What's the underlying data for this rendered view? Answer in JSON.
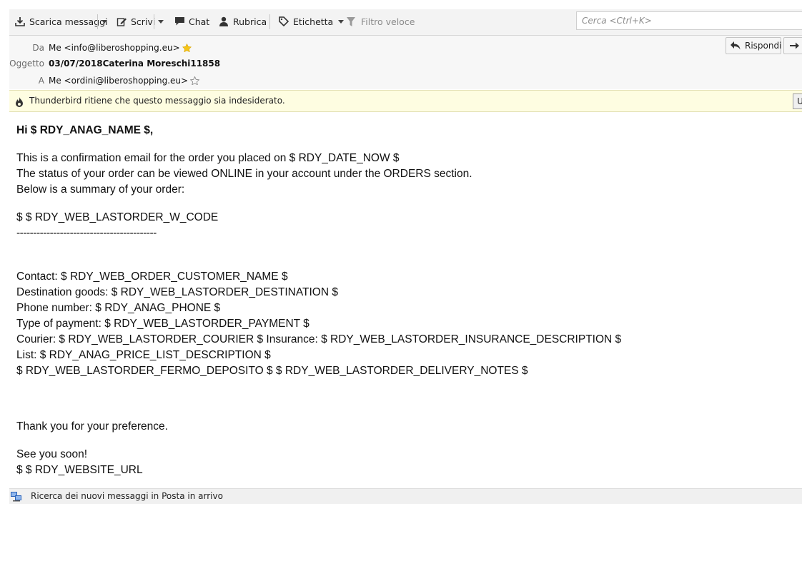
{
  "toolbar": {
    "get_messages": "Scarica messaggi",
    "write": "Scrivi",
    "chat": "Chat",
    "address_book": "Rubrica",
    "tag": "Etichetta",
    "quick_filter": "Filtro veloce",
    "search_placeholder": "Cerca <Ctrl+K>"
  },
  "header": {
    "from_label": "Da",
    "from_value": "Me <info@liberoshopping.eu>",
    "subject_label": "Oggetto",
    "subject_value": "03/07/2018Caterina Moreschi11858",
    "to_label": "A",
    "to_value": "Me <ordini@liberoshopping.eu>",
    "reply_label": "Rispondi"
  },
  "junk_bar": {
    "text": "Thunderbird ritiene che questo messaggio sia indesiderato.",
    "button_label": "U"
  },
  "message": {
    "greeting": "Hi $ RDY_ANAG_NAME $,",
    "line1": "This is a confirmation email for the order you placed on $ RDY_DATE_NOW $",
    "line2": "The status of your order can be viewed ONLINE in your account under the ORDERS section.",
    "line3": "Below is a summary of your order:",
    "order_code": "$ $ RDY_WEB_LASTORDER_W_CODE",
    "divider": "------------------------------------------",
    "contact": "Contact: $ RDY_WEB_ORDER_CUSTOMER_NAME $",
    "destination": "Destination goods: $ RDY_WEB_LASTORDER_DESTINATION $",
    "phone": "Phone number: $ RDY_ANAG_PHONE $",
    "payment": "Type of payment: $ RDY_WEB_LASTORDER_PAYMENT $",
    "courier": "Courier: $ RDY_WEB_LASTORDER_COURIER $ Insurance: $ RDY_WEB_LASTORDER_INSURANCE_DESCRIPTION $",
    "list": "List: $ RDY_ANAG_PRICE_LIST_DESCRIPTION $",
    "fermo": "$ RDY_WEB_LASTORDER_FERMO_DEPOSITO $ $ RDY_WEB_LASTORDER_DELIVERY_NOTES $",
    "thanks": "Thank you for your preference.",
    "see_you": "See you soon!",
    "website": "$ $ RDY_WEBSITE_URL"
  },
  "status_bar": {
    "text": "Ricerca dei nuovi messaggi in Posta in arrivo"
  },
  "colors": {
    "toolbar_bg": "#f3f3f3",
    "header_bg": "#f7f7f7",
    "junk_bg": "#fefde1",
    "star_gold": "#f5c518"
  },
  "icons": [
    "download-icon",
    "pencil-icon",
    "chat-bubble-icon",
    "person-icon",
    "tag-icon",
    "filter-icon",
    "star-icon",
    "reply-icon",
    "forward-icon",
    "junk-flame-icon",
    "network-activity-icon"
  ]
}
